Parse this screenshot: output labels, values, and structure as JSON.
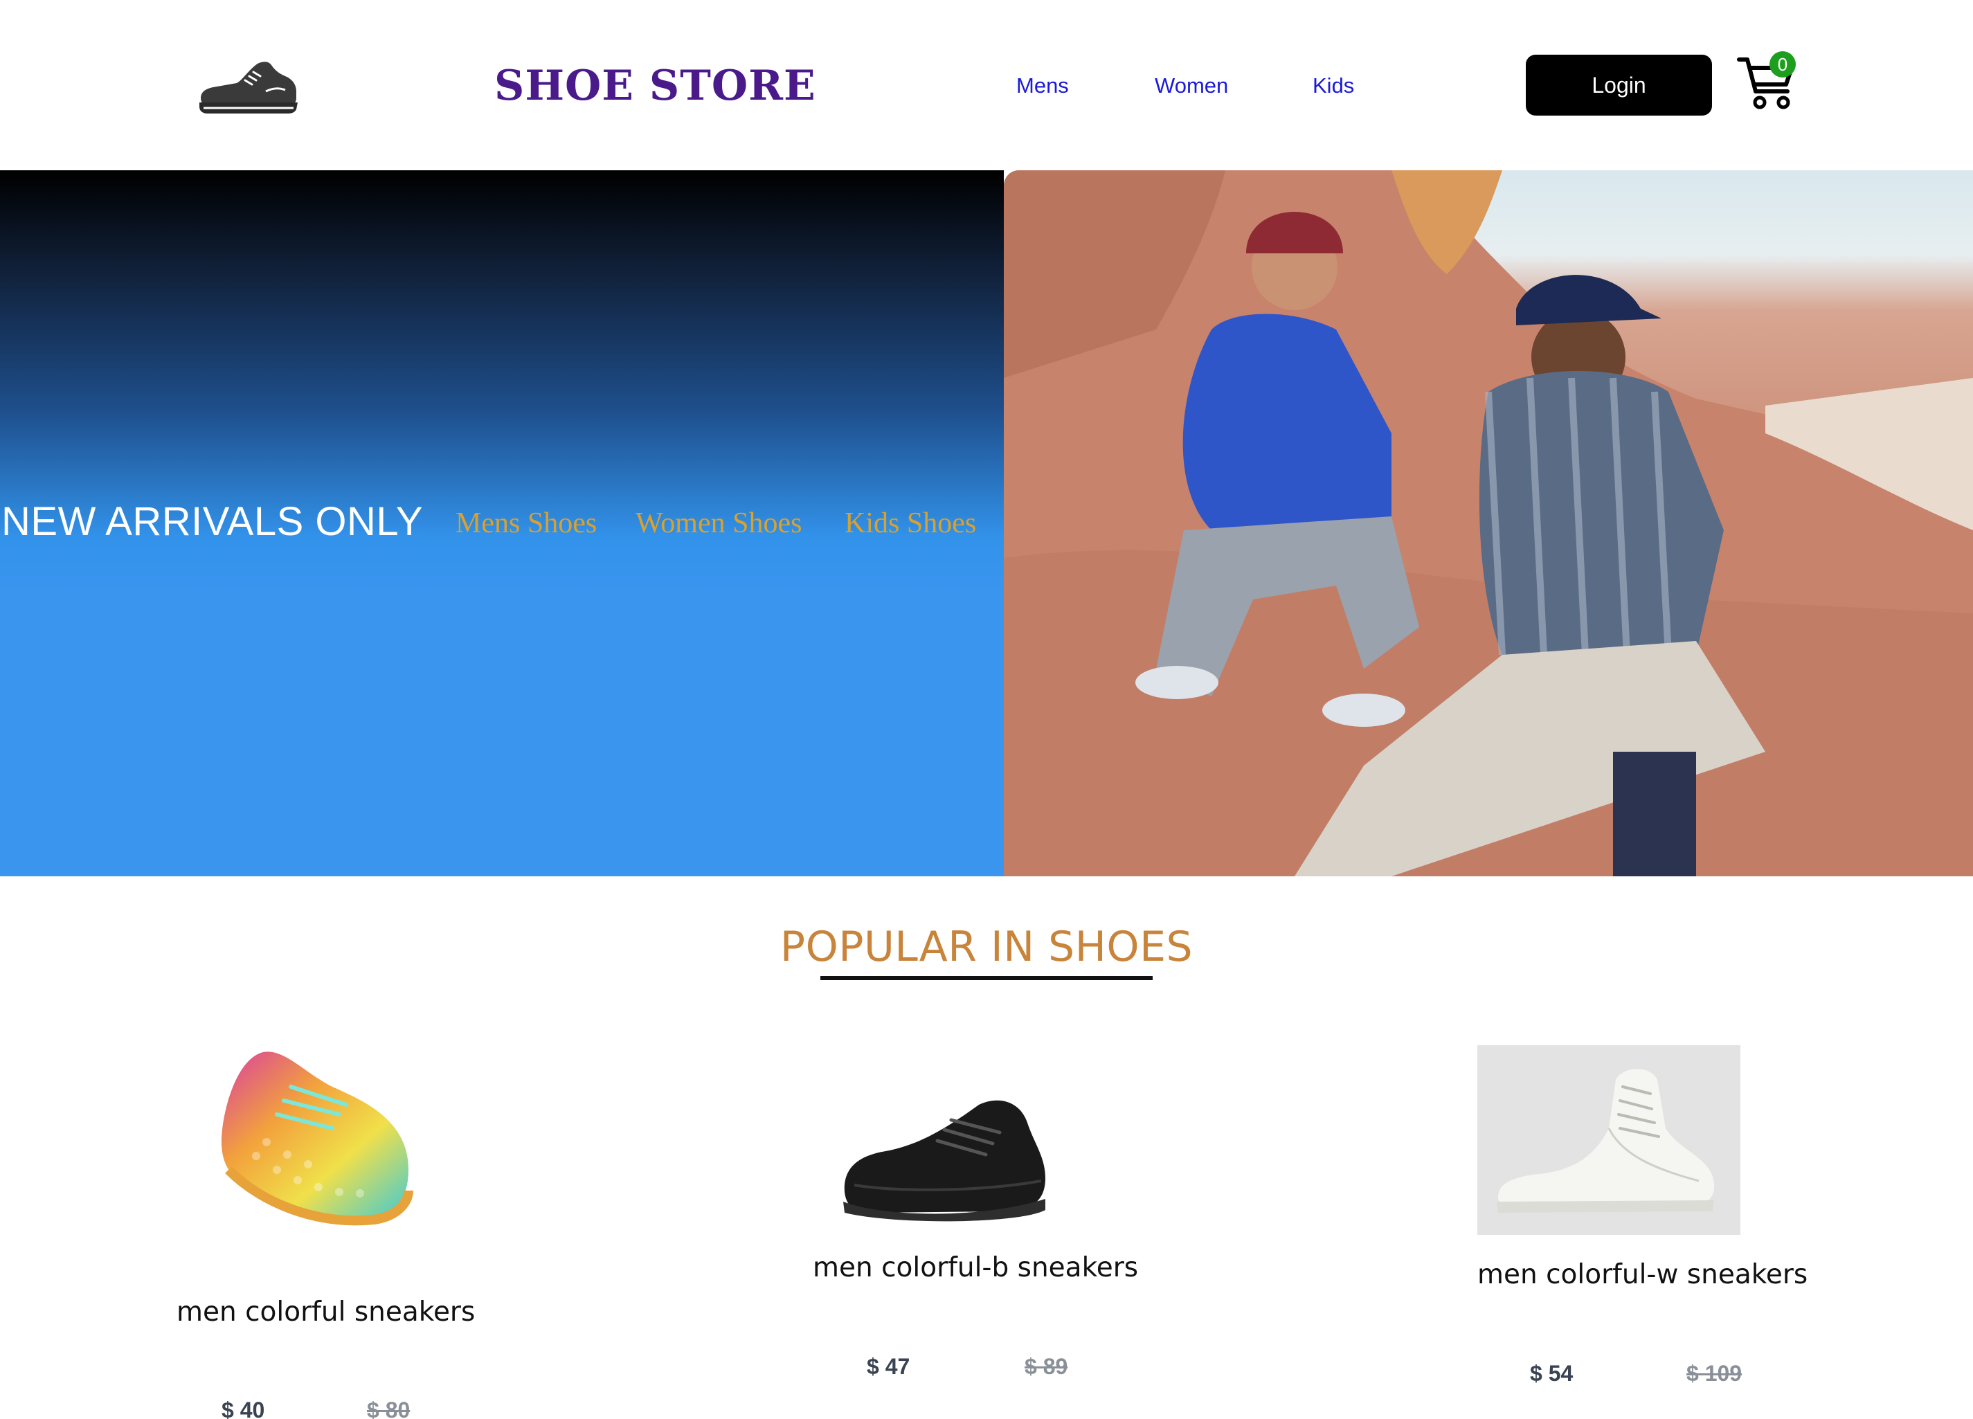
{
  "header": {
    "brand": "SHOE STORE",
    "nav": [
      "Mens",
      "Women",
      "Kids"
    ],
    "login_label": "Login",
    "cart_count": "0"
  },
  "hero": {
    "title": "NEW ARRIVALS ONLY",
    "links": [
      "Mens Shoes",
      "Women Shoes",
      "Kids Shoes"
    ]
  },
  "popular": {
    "title": "POPULAR IN SHOES",
    "products": [
      {
        "name": "men colorful sneakers",
        "price": "$ 40",
        "old_price": "$ 80"
      },
      {
        "name": "men colorful-b sneakers",
        "price": "$ 47",
        "old_price": "$ 89"
      },
      {
        "name": "men colorful-w sneakers",
        "price": "$ 54",
        "old_price": "$ 109"
      }
    ]
  },
  "colors": {
    "brand": "#4a1a8a",
    "nav_link": "#1a1ad9",
    "hero_link": "#d9a12e",
    "popular_title": "#c8843a",
    "cart_badge": "#1e9e1e"
  }
}
